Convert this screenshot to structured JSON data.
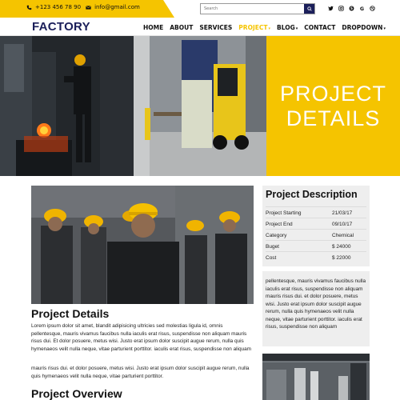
{
  "topbar": {
    "phone": "+123 456 78 90",
    "email": "info@gmail.com",
    "search_placeholder": "Search",
    "socials": [
      "twitter-icon",
      "instagram-icon",
      "skype-icon",
      "google-icon",
      "dribbble-icon"
    ]
  },
  "header": {
    "logo": "FACTORY",
    "nav": [
      {
        "label": "HOME",
        "active": false
      },
      {
        "label": "ABOUT",
        "active": false
      },
      {
        "label": "SERVICES",
        "active": false
      },
      {
        "label": "PROJECT",
        "active": true,
        "dropdown": true
      },
      {
        "label": "BLOG",
        "active": false,
        "dropdown": true
      },
      {
        "label": "CONTACT",
        "active": false
      },
      {
        "label": "DROPDOWN",
        "active": false,
        "dropdown": true
      }
    ]
  },
  "hero": {
    "title_line1": "PROJECT",
    "title_line2": "DETAILS"
  },
  "main": {
    "details_title": "Project Details",
    "details_p1": "Lorem ipsum dolor sit amet, blandit adipisicing ultricies sed molestias ligula id, omnis pellentesque, mauris vivamus faucibus nulla iaculis erat risus, suspendisse non aliquam mauris risus dui. Et dolor posuere, metus wisi. Justo erat ipsum dolor suscipit augue rerum, nulla quis hymenaeos velit nulla neque, vitae parturient porttitor. iaculis erat risus, suspendisse non aliquam",
    "details_p2": "mauris risus dui. et dolor posuere, metus wisi. Justo erat ipsum dolor suscipit augue rerum, nulla quis hymenaeos velit nulla neque, vitae parturient porttitor.",
    "overview_title": "Project Overview"
  },
  "sidebar": {
    "desc_title": "Project Description",
    "rows": [
      {
        "key": "Project Starting",
        "value": "21/03/17"
      },
      {
        "key": "Project End",
        "value": "09/10/17"
      },
      {
        "key": "Category",
        "value": "Chemical"
      },
      {
        "key": "Buget",
        "value": "$ 24000"
      },
      {
        "key": "Cost",
        "value": "$ 22000"
      }
    ],
    "paragraph": "pellentesque, mauris vivamus faucibus nulla iaculis erat risus, suspendisse non aliquam mauris risus dui. et dolor posuere, metus wisi. Justo erat ipsum dolor suscipit augue rerum, nulla quis hymenaeos velit nulla neque, vitae parturient porttitor. iaculis erat risus, suspendisse non aliquam"
  },
  "colors": {
    "accent": "#f5c400",
    "navy": "#1b1f5a"
  }
}
